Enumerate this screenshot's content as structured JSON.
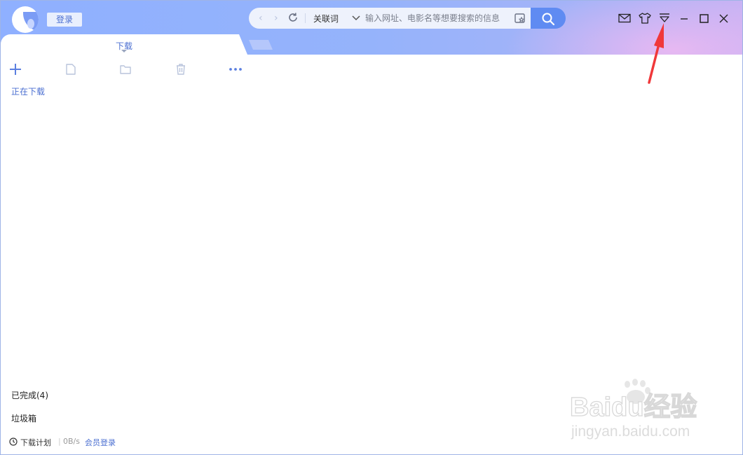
{
  "header": {
    "login_label": "登录",
    "keyword_label": "关联词",
    "search_placeholder": "输入网址、电影名等想要搜索的信息"
  },
  "tabs": {
    "active_label": "下载"
  },
  "sidebar": {
    "downloading": "正在下载",
    "completed": "已完成(4)",
    "trash": "垃圾箱"
  },
  "footer": {
    "schedule": "下载计划",
    "speed": "0B/s",
    "vip_login": "会员登录"
  },
  "watermark": {
    "brand": "Baidu经验",
    "url": "jingyan.baidu.com"
  },
  "colors": {
    "accent": "#4b6fd1",
    "search_button": "#5f8bf2",
    "annotation_arrow": "#f0383a"
  },
  "icons": [
    "logo-icon",
    "back-icon",
    "forward-icon",
    "refresh-icon",
    "dropdown-icon",
    "favorite-icon",
    "search-icon",
    "mail-icon",
    "skin-icon",
    "menu-icon",
    "minimize-icon",
    "maximize-icon",
    "close-icon",
    "add-icon",
    "file-icon",
    "folder-icon",
    "delete-icon",
    "more-icon",
    "clock-icon"
  ]
}
